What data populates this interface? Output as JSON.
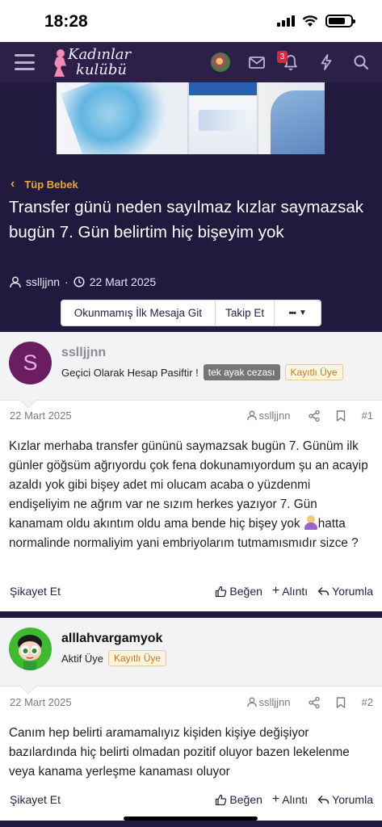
{
  "status_bar": {
    "time": "18:28"
  },
  "header": {
    "logo_line1": "Kadınlar",
    "logo_line2": "kulübü",
    "notification_count": "3"
  },
  "breadcrumb": {
    "label": "Tüp Bebek"
  },
  "thread": {
    "title": "Transfer günü neden sayılmaz kızlar saymazsak bugün 7. Gün belirtim hiç bişeyim yok",
    "author": "ssllјjnn",
    "date": "22 Mart 2025"
  },
  "thread_buttons": {
    "unread": "Okunmamış İlk Mesaja Git",
    "watch": "Takip Et",
    "more": "•••"
  },
  "posts": [
    {
      "avatar_letter": "S",
      "username": "ssllјjnn",
      "user_title": "Geçici Olarak Hesap Pasiftir !",
      "tags": [
        "tek ayak cezası",
        "Kayıtlı Üye"
      ],
      "date": "22 Mart 2025",
      "quote_user": "ssllјjnn",
      "number": "#1",
      "body_part1": "Kızlar merhaba transfer gününü saymazsak bugün 7. Günüm ilk günler göğsüm ağrıyordu çok fena dokunamıyordum şu an acayip azaldı yok gibi bişey adet mi olucam acaba o yüzdenmi endişeliyim ne ağrım var ne sızım herkes yazıyor 7. Gün kanamam oldu akıntım oldu ama bende hiç bişey yok ",
      "body_part2": "hatta normalinde normaliyim yani embriyolarım tutmamısmıdır sizce ?",
      "actions": {
        "report": "Şikayet Et",
        "like": "Beğen",
        "quote": "Alıntı",
        "reply": "Yorumla"
      }
    },
    {
      "username": "alllahvargamyok",
      "user_title": "Aktif Üye",
      "tags": [
        "Kayıtlı Üye"
      ],
      "date": "22 Mart 2025",
      "quote_user": "ssllјjnn",
      "number": "#2",
      "body": "Canım hep belirti aramamalıyız kişiden kişiye değişiyor bazılardında hiç belirti olmadan pozitif oluyor bazen lekelenme veya kanama yerleşme kanaması oluyor",
      "actions": {
        "report": "Şikayet Et",
        "like": "Beğen",
        "quote": "Alıntı",
        "reply": "Yorumla"
      }
    }
  ],
  "colors": {
    "nav_bg": "#2a2048",
    "page_bg": "#22193f",
    "accent": "#e7a73e"
  }
}
